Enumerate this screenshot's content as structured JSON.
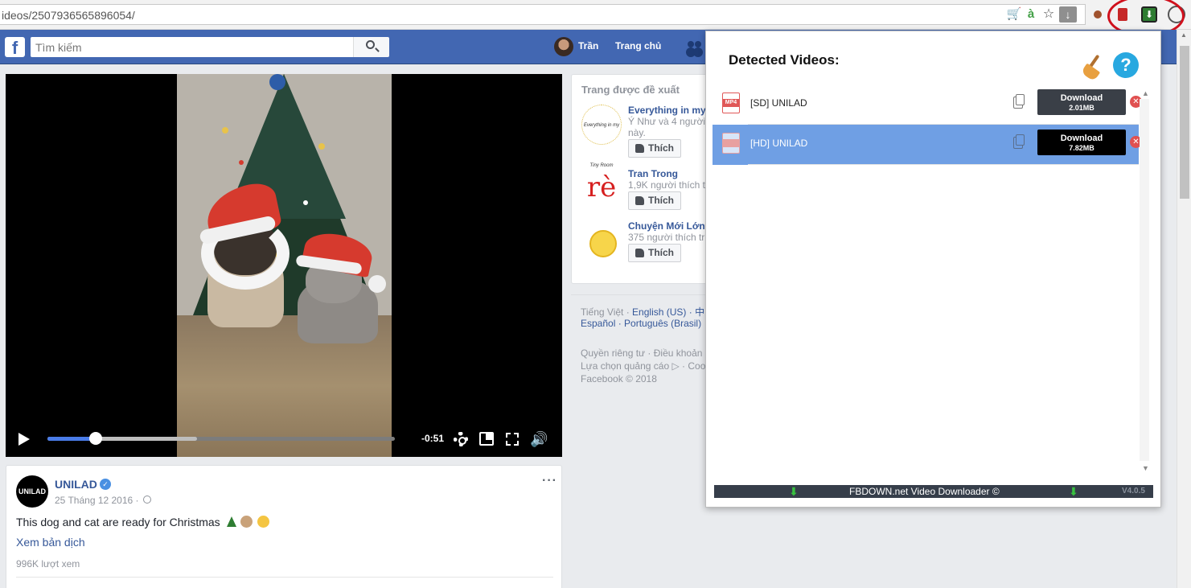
{
  "browser": {
    "url": "ideos/2507936565896054/",
    "icons": [
      "cart-icon",
      "a-icon",
      "star-icon",
      "download-arrow-icon",
      "extension-icon",
      "extension-red-icon",
      "fbdown-extension-icon",
      "profile-circle-icon"
    ],
    "annotation_color": "#d0101c"
  },
  "fb": {
    "search_placeholder": "Tìm kiếm",
    "user_name": "Trần",
    "home_label": "Trang chủ",
    "brand_color": "#4267b2"
  },
  "video": {
    "time_remaining": "-0:51",
    "progress_played_fraction": 0.14,
    "progress_buffered_fraction": 0.43,
    "accent_color": "#4a7ce8"
  },
  "post": {
    "page_avatar_text": "UNILAD",
    "page_name": "UNILAD",
    "date": "25 Tháng 12 2016 ·",
    "text": "This dog and cat are ready for Christmas",
    "translate_link": "Xem bản dịch",
    "views": "996K lượt xem"
  },
  "suggestions": {
    "title": "Trang được đề xuất",
    "items": [
      {
        "name": "Everything in my",
        "sub1": "Ý Như và 4 người",
        "sub2": "này.",
        "like": "Thích",
        "avatar_text": "Everything in my Tiny Room"
      },
      {
        "name": "Tran Trong",
        "sub1": "1,9K người thích t",
        "like": "Thích",
        "avatar_text": "rè"
      },
      {
        "name": "Chuyện Mới Lớn",
        "sub1": "375 người thích tr",
        "like": "Thích"
      }
    ]
  },
  "footer": {
    "lang_current": "Tiếng Việt ·",
    "lang_en": "English (US) ·",
    "lang_cjk": "中",
    "lang_es": "Español ·",
    "lang_pt": "Português (Brasil)",
    "links1": "Quyền riêng tư · Điều khoản",
    "links2": "Lựa chọn quảng cáo ▷ · Coo",
    "copyright": "Facebook © 2018"
  },
  "popup": {
    "title": "Detected Videos:",
    "videos": [
      {
        "badge": "MP4",
        "name": "[SD] UNILAD",
        "button": "Download",
        "size": "2.01MB",
        "selected": false
      },
      {
        "badge": "MP4",
        "name": "[HD] UNILAD",
        "button": "Download",
        "size": "7.82MB",
        "selected": true
      }
    ],
    "brand": "FBDOWN.net Video Downloader ©",
    "version": "V4.0.5",
    "selected_color": "#6f9fe4",
    "footer_arrow_color": "#38c040"
  }
}
